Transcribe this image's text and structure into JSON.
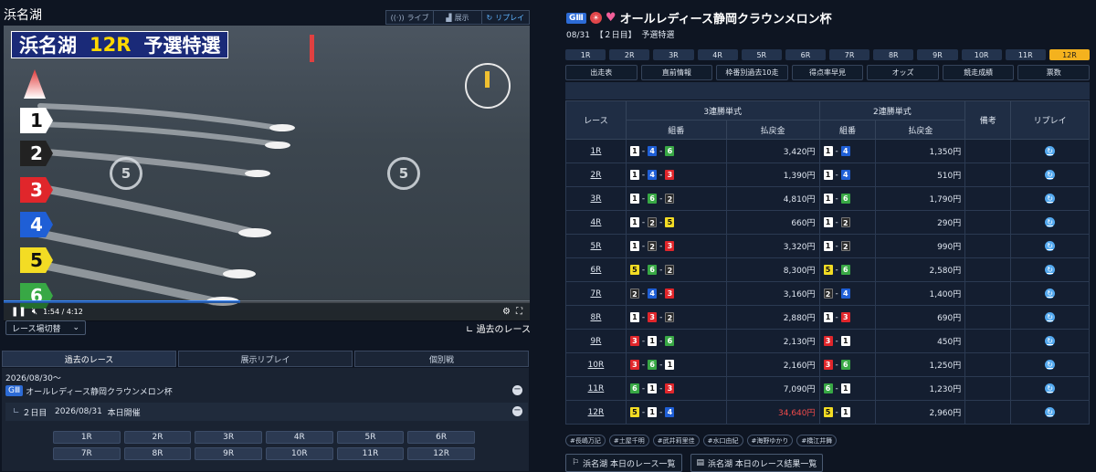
{
  "venue": "浜名湖",
  "mode_tabs": [
    {
      "label": "ライブ",
      "icon": "broadcast-icon"
    },
    {
      "label": "展示",
      "icon": "chart-icon"
    },
    {
      "label": "リプレイ",
      "icon": "replay-icon"
    }
  ],
  "video": {
    "overlay_venue": "浜名湖",
    "overlay_race": "12R",
    "overlay_type": "予選特選",
    "lanes": [
      "1",
      "2",
      "3",
      "4",
      "5",
      "6"
    ],
    "replay_seconds": "5",
    "time": "1:54 / 4:12",
    "progress": 0.45
  },
  "race_switch": "レース場切替",
  "past_race_link": "過去のレース",
  "left_tabs": [
    "過去のレース",
    "展示リプレイ",
    "個別戦"
  ],
  "past": {
    "period": "2026/08/30〜",
    "grade": "GⅢ",
    "event": "オールレディース静岡クラウンメロン杯",
    "day": "２日目",
    "date": "2026/08/31",
    "status": "本日開催",
    "races": [
      "1R",
      "2R",
      "3R",
      "4R",
      "5R",
      "6R",
      "7R",
      "8R",
      "9R",
      "10R",
      "11R",
      "12R"
    ]
  },
  "event": {
    "grade": "GⅢ",
    "title": "オールレディース静岡クラウンメロン杯",
    "date": "08/31",
    "day": "【２日目】",
    "race_type": "予選特選"
  },
  "race_numbers": [
    "1R",
    "2R",
    "3R",
    "4R",
    "5R",
    "6R",
    "7R",
    "8R",
    "9R",
    "10R",
    "11R",
    "12R"
  ],
  "active_race": "12R",
  "sub_tabs": [
    "出走表",
    "直前情報",
    "枠番別過去10走",
    "得点率早見",
    "オッズ",
    "競走成績",
    "票数"
  ],
  "table": {
    "h_race": "レース",
    "h_tri": "3連勝単式",
    "h_exa": "2連勝単式",
    "h_note": "備考",
    "h_replay": "リプレイ",
    "h_combo": "組番",
    "h_pay": "払戻金",
    "rows": [
      {
        "race": "1R",
        "tri": [
          "1",
          "4",
          "6"
        ],
        "tri_pay": "3,420円",
        "exa": [
          "1",
          "4"
        ],
        "exa_pay": "1,350円"
      },
      {
        "race": "2R",
        "tri": [
          "1",
          "4",
          "3"
        ],
        "tri_pay": "1,390円",
        "exa": [
          "1",
          "4"
        ],
        "exa_pay": "510円"
      },
      {
        "race": "3R",
        "tri": [
          "1",
          "6",
          "2"
        ],
        "tri_pay": "4,810円",
        "exa": [
          "1",
          "6"
        ],
        "exa_pay": "1,790円"
      },
      {
        "race": "4R",
        "tri": [
          "1",
          "2",
          "5"
        ],
        "tri_pay": "660円",
        "exa": [
          "1",
          "2"
        ],
        "exa_pay": "290円"
      },
      {
        "race": "5R",
        "tri": [
          "1",
          "2",
          "3"
        ],
        "tri_pay": "3,320円",
        "exa": [
          "1",
          "2"
        ],
        "exa_pay": "990円"
      },
      {
        "race": "6R",
        "tri": [
          "5",
          "6",
          "2"
        ],
        "tri_pay": "8,300円",
        "exa": [
          "5",
          "6"
        ],
        "exa_pay": "2,580円"
      },
      {
        "race": "7R",
        "tri": [
          "2",
          "4",
          "3"
        ],
        "tri_pay": "3,160円",
        "exa": [
          "2",
          "4"
        ],
        "exa_pay": "1,400円"
      },
      {
        "race": "8R",
        "tri": [
          "1",
          "3",
          "2"
        ],
        "tri_pay": "2,880円",
        "exa": [
          "1",
          "3"
        ],
        "exa_pay": "690円"
      },
      {
        "race": "9R",
        "tri": [
          "3",
          "1",
          "6"
        ],
        "tri_pay": "2,130円",
        "exa": [
          "3",
          "1"
        ],
        "exa_pay": "450円"
      },
      {
        "race": "10R",
        "tri": [
          "3",
          "6",
          "1"
        ],
        "tri_pay": "2,160円",
        "exa": [
          "3",
          "6"
        ],
        "exa_pay": "1,250円"
      },
      {
        "race": "11R",
        "tri": [
          "6",
          "1",
          "3"
        ],
        "tri_pay": "7,090円",
        "exa": [
          "6",
          "1"
        ],
        "exa_pay": "1,230円"
      },
      {
        "race": "12R",
        "tri": [
          "5",
          "1",
          "4"
        ],
        "tri_pay": "34,640円",
        "tri_high": true,
        "exa": [
          "5",
          "1"
        ],
        "exa_pay": "2,960円"
      }
    ]
  },
  "tags": [
    "#長嶋万記",
    "#土屋千明",
    "#武井莉里佳",
    "#水口由紀",
    "#海野ゆかり",
    "#橋江井舞"
  ],
  "footer_buttons": [
    "浜名湖 本日のレース一覧",
    "浜名湖 本日のレース結果一覧"
  ],
  "colors": {
    "accent": "#f4b21e",
    "high_payout": "#f04a4a",
    "replay": "#55aaf0",
    "progress": "#3d8bff"
  }
}
